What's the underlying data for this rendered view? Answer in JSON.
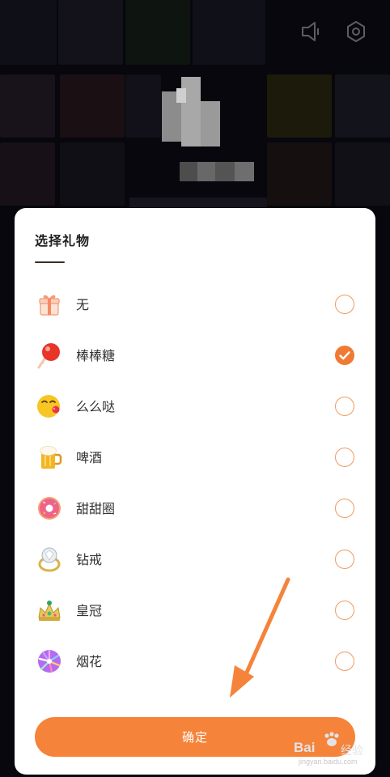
{
  "modal": {
    "title": "选择礼物",
    "confirm_label": "确定"
  },
  "gifts": [
    {
      "label": "无",
      "icon": "gift-box-icon",
      "selected": false
    },
    {
      "label": "棒棒糖",
      "icon": "lollipop-icon",
      "selected": true
    },
    {
      "label": "么么哒",
      "icon": "kiss-emoji-icon",
      "selected": false
    },
    {
      "label": "啤酒",
      "icon": "beer-mug-icon",
      "selected": false
    },
    {
      "label": "甜甜圈",
      "icon": "donut-icon",
      "selected": false
    },
    {
      "label": "钻戒",
      "icon": "diamond-ring-icon",
      "selected": false
    },
    {
      "label": "皇冠",
      "icon": "crown-icon",
      "selected": false
    },
    {
      "label": "烟花",
      "icon": "fireworks-icon",
      "selected": false
    }
  ],
  "background": {
    "icons": [
      "speaker-icon",
      "settings-icon"
    ]
  },
  "watermark": {
    "brand": "Bai",
    "brand_tail": "经验",
    "sub": "jingyan.baidu.com"
  },
  "colors": {
    "accent": "#f5833a",
    "radio_border": "#ee9a60",
    "checked": "#f07a34",
    "sheet": "#ffffff"
  }
}
